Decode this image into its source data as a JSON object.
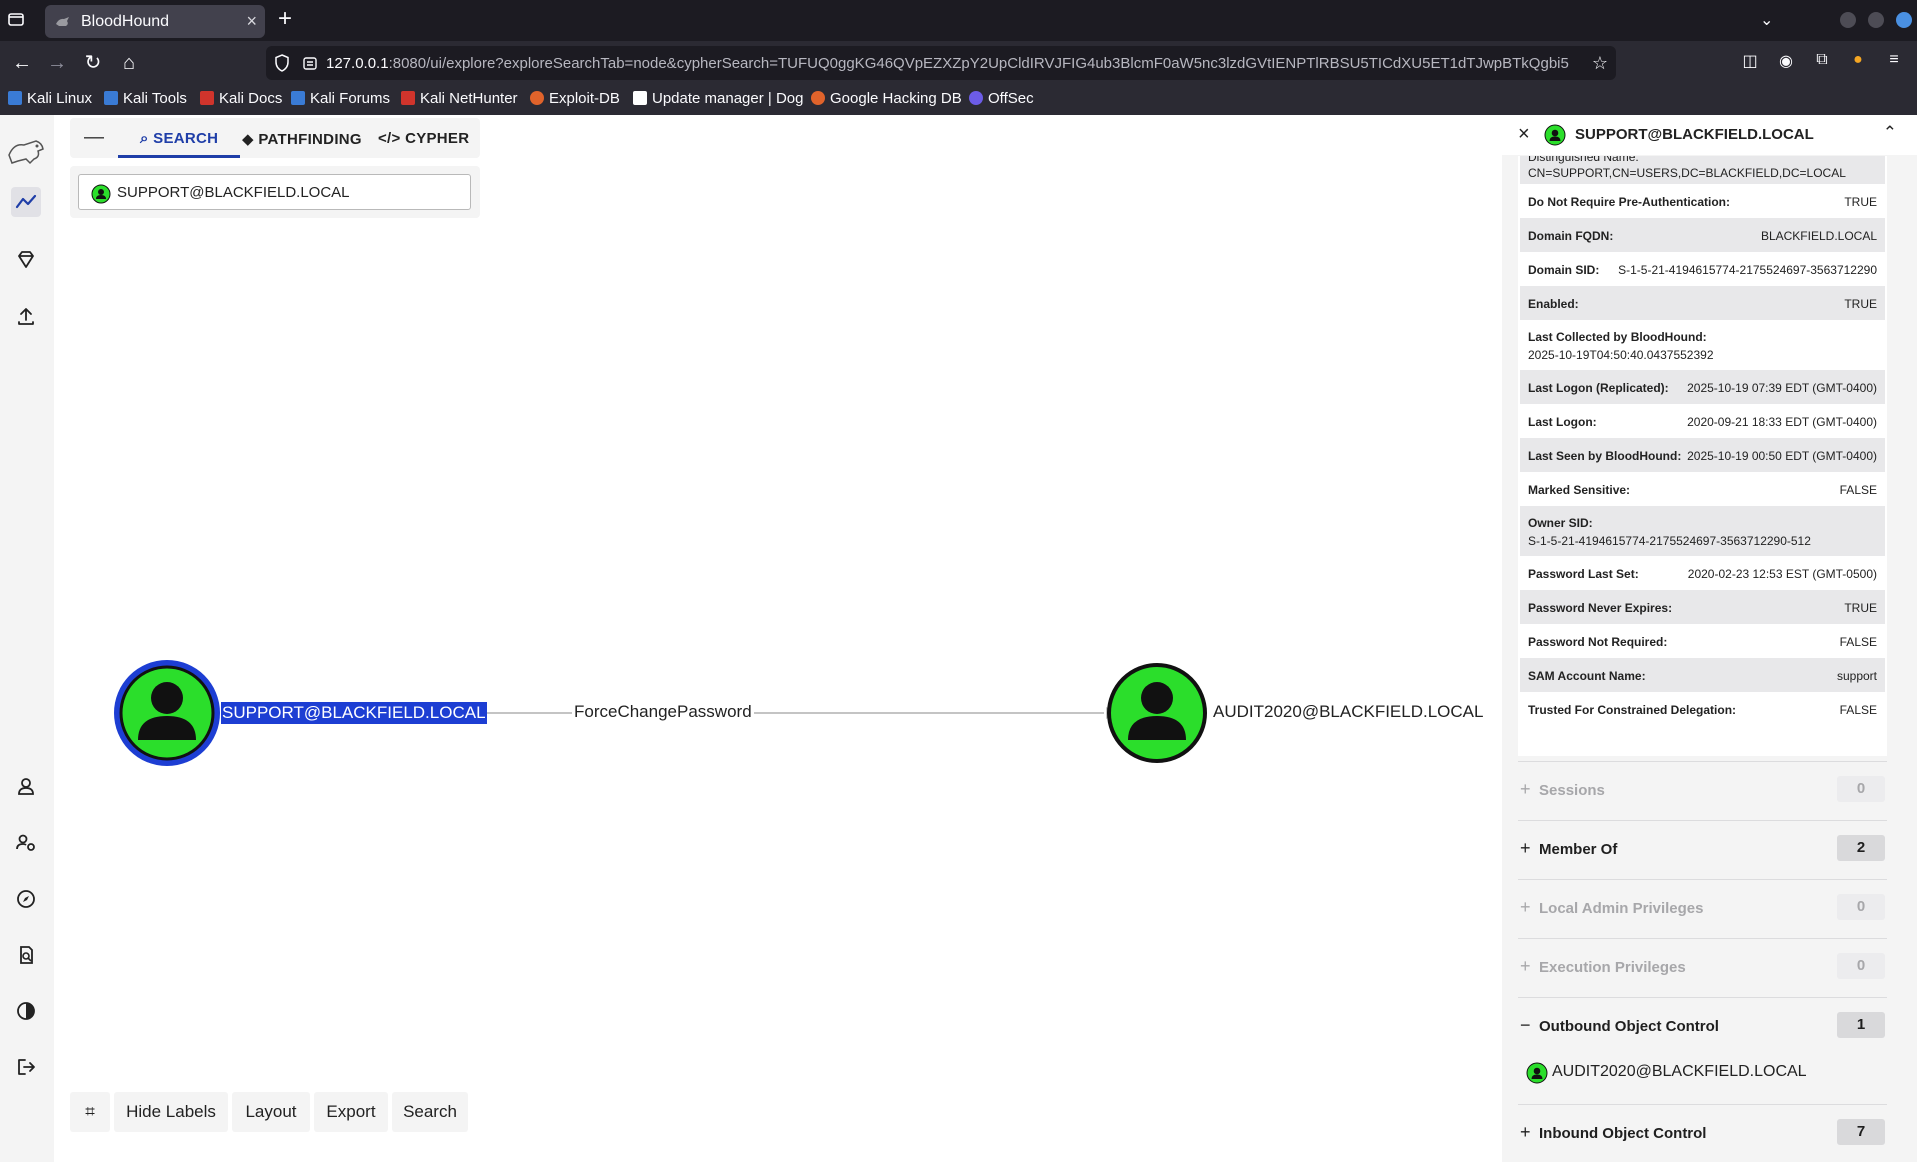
{
  "browser": {
    "tab_title": "BloodHound",
    "url_host": "127.0.0.1",
    "url_rest": ":8080/ui/explore?exploreSearchTab=node&cypherSearch=TUFUQ0ggKG46QVpEZXZpY2UpCldIRVJFIG4ub3BlcmF0aW5nc3lzdGVtIENPTlRBSU5TICdXU5ET1dTJwpBTkQgbi5"
  },
  "bookmarks": [
    {
      "label": "Kali Linux",
      "color": "#3a7bd5"
    },
    {
      "label": "Kali Tools",
      "color": "#3a7bd5"
    },
    {
      "label": "Kali Docs",
      "color": "#d0342c"
    },
    {
      "label": "Kali Forums",
      "color": "#3a7bd5"
    },
    {
      "label": "Kali NetHunter",
      "color": "#d0342c"
    },
    {
      "label": "Exploit-DB",
      "color": "#e0632b"
    },
    {
      "label": "Update manager | Dog",
      "color": "#ffffff"
    },
    {
      "label": "Google Hacking DB",
      "color": "#e0632b"
    },
    {
      "label": "OffSec",
      "color": "#6c5ce7"
    }
  ],
  "search_panel": {
    "tabs": [
      "SEARCH",
      "PATHFINDING",
      "CYPHER"
    ],
    "active_tab": "SEARCH",
    "search_value": "SUPPORT@BLACKFIELD.LOCAL"
  },
  "graph": {
    "source": "SUPPORT@BLACKFIELD.LOCAL",
    "edge": "ForceChangePassword",
    "target": "AUDIT2020@BLACKFIELD.LOCAL",
    "node_color": "#2bde2b",
    "selected_color": "#1d3ed3"
  },
  "bottom_buttons": [
    "Hide Labels",
    "Layout",
    "Export",
    "Search"
  ],
  "entity": {
    "name": "SUPPORT@BLACKFIELD.LOCAL",
    "properties": [
      {
        "key": "Distinguished Name:",
        "value": "CN=SUPPORT,CN=USERS,DC=BLACKFIELD,DC=LOCAL"
      },
      {
        "key": "Do Not Require Pre-Authentication:",
        "value": "TRUE"
      },
      {
        "key": "Domain FQDN:",
        "value": "BLACKFIELD.LOCAL"
      },
      {
        "key": "Domain SID:",
        "value": "S-1-5-21-4194615774-2175524697-3563712290"
      },
      {
        "key": "Enabled:",
        "value": "TRUE"
      },
      {
        "key": "Last Collected by BloodHound:",
        "value": "2025-10-19T04:50:40.0437552392"
      },
      {
        "key": "Last Logon (Replicated):",
        "value": "2025-10-19 07:39 EDT (GMT-0400)"
      },
      {
        "key": "Last Logon:",
        "value": "2020-09-21 18:33 EDT (GMT-0400)"
      },
      {
        "key": "Last Seen by BloodHound:",
        "value": "2025-10-19 00:50 EDT (GMT-0400)"
      },
      {
        "key": "Marked Sensitive:",
        "value": "FALSE"
      },
      {
        "key": "Owner SID:",
        "value": "S-1-5-21-4194615774-2175524697-3563712290-512"
      },
      {
        "key": "Password Last Set:",
        "value": "2020-02-23 12:53 EST (GMT-0500)"
      },
      {
        "key": "Password Never Expires:",
        "value": "TRUE"
      },
      {
        "key": "Password Not Required:",
        "value": "FALSE"
      },
      {
        "key": "SAM Account Name:",
        "value": "support"
      },
      {
        "key": "Trusted For Constrained Delegation:",
        "value": "FALSE"
      }
    ],
    "sections": [
      {
        "label": "Sessions",
        "count": "0",
        "sign": "+"
      },
      {
        "label": "Member Of",
        "count": "2",
        "sign": "+"
      },
      {
        "label": "Local Admin Privileges",
        "count": "0",
        "sign": "+"
      },
      {
        "label": "Execution Privileges",
        "count": "0",
        "sign": "+"
      },
      {
        "label": "Outbound Object Control",
        "count": "1",
        "sign": "−"
      },
      {
        "label": "Inbound Object Control",
        "count": "7",
        "sign": "+"
      }
    ],
    "outbound_item": "AUDIT2020@BLACKFIELD.LOCAL"
  }
}
